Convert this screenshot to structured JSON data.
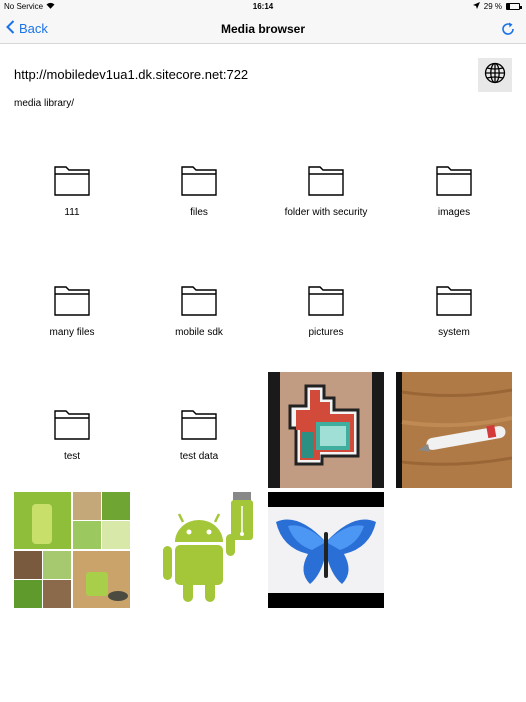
{
  "status": {
    "carrier": "No Service",
    "time": "16:14",
    "battery": "29 %",
    "battery_level": 0.29
  },
  "nav": {
    "back_label": "Back",
    "title": "Media browser"
  },
  "server": {
    "url": "http://mobiledev1ua1.dk.sitecore.net:722",
    "path": "media library/"
  },
  "folders": [
    {
      "label": "111"
    },
    {
      "label": "files"
    },
    {
      "label": "folder with security"
    },
    {
      "label": "images"
    },
    {
      "label": "many files"
    },
    {
      "label": "mobile sdk"
    },
    {
      "label": "pictures"
    },
    {
      "label": "system"
    },
    {
      "label": "test"
    },
    {
      "label": "test data"
    }
  ],
  "media_items": [
    {
      "icon": "pixel-thumbs-up-sticker-image"
    },
    {
      "icon": "pen-on-wooden-table-image"
    },
    {
      "icon": "spa-collage-image"
    },
    {
      "icon": "android-usb-image"
    },
    {
      "icon": "blue-butterfly-image"
    }
  ],
  "colors": {
    "accent": "#1a73e8",
    "android_green": "#a4c639"
  }
}
